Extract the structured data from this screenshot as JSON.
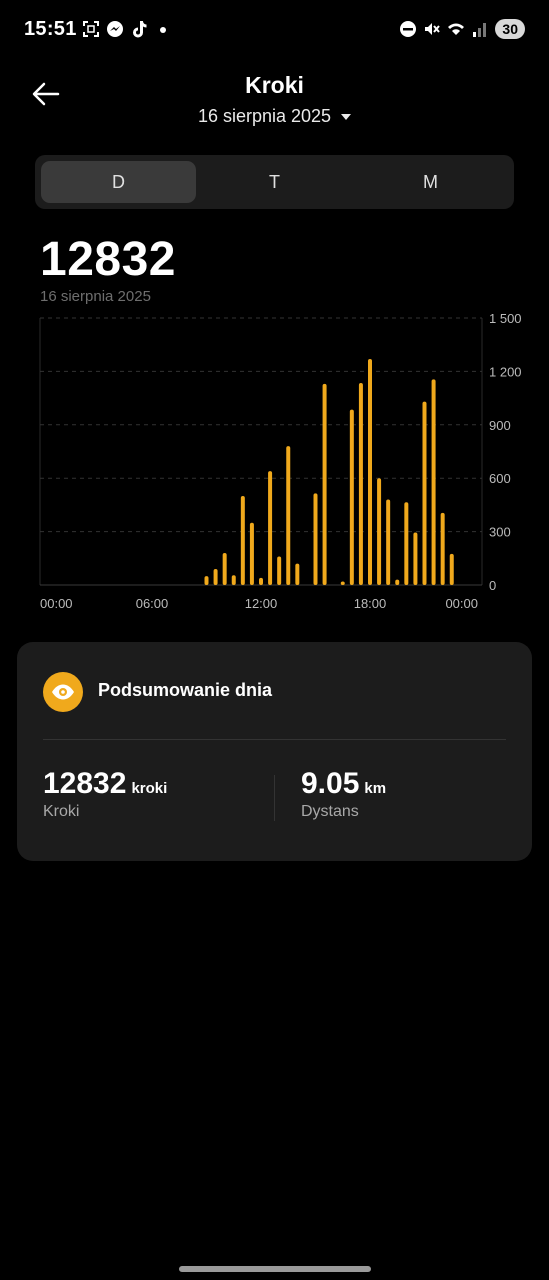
{
  "status_bar": {
    "time": "15:51",
    "battery": "30"
  },
  "header": {
    "title": "Kroki",
    "date": "16 sierpnia 2025"
  },
  "tabs": [
    {
      "label": "D",
      "active": true
    },
    {
      "label": "T",
      "active": false
    },
    {
      "label": "M",
      "active": false
    }
  ],
  "summary": {
    "total": "12832",
    "date": "16 sierpnia 2025"
  },
  "chart_data": {
    "type": "bar",
    "bar_color": "#f0a91c",
    "x_tick_labels": [
      "00:00",
      "06:00",
      "12:00",
      "18:00",
      "00:00"
    ],
    "y_ticks": [
      0,
      300,
      600,
      900,
      1200,
      1500
    ],
    "y_tick_labels": [
      "0",
      "300",
      "600",
      "900",
      "1 200",
      "1 500"
    ],
    "ylim": [
      0,
      1500
    ],
    "xlim_hours": [
      0,
      24
    ],
    "grid": true,
    "bars": [
      {
        "hour": 9.0,
        "value": 50
      },
      {
        "hour": 9.5,
        "value": 90
      },
      {
        "hour": 10.0,
        "value": 180
      },
      {
        "hour": 10.5,
        "value": 55
      },
      {
        "hour": 11.0,
        "value": 500
      },
      {
        "hour": 11.5,
        "value": 350
      },
      {
        "hour": 12.0,
        "value": 40
      },
      {
        "hour": 12.5,
        "value": 640
      },
      {
        "hour": 13.0,
        "value": 160
      },
      {
        "hour": 13.5,
        "value": 780
      },
      {
        "hour": 14.0,
        "value": 120
      },
      {
        "hour": 15.0,
        "value": 515
      },
      {
        "hour": 15.5,
        "value": 1130
      },
      {
        "hour": 16.5,
        "value": 20
      },
      {
        "hour": 17.0,
        "value": 985
      },
      {
        "hour": 17.5,
        "value": 1135
      },
      {
        "hour": 18.0,
        "value": 1270
      },
      {
        "hour": 18.5,
        "value": 600
      },
      {
        "hour": 19.0,
        "value": 480
      },
      {
        "hour": 19.5,
        "value": 30
      },
      {
        "hour": 20.0,
        "value": 465
      },
      {
        "hour": 20.5,
        "value": 295
      },
      {
        "hour": 21.0,
        "value": 1030
      },
      {
        "hour": 21.5,
        "value": 1155
      },
      {
        "hour": 22.0,
        "value": 405
      },
      {
        "hour": 22.5,
        "value": 175
      }
    ]
  },
  "day_summary": {
    "title": "Podsumowanie dnia",
    "steps_value": "12832",
    "steps_unit": "kroki",
    "steps_label": "Kroki",
    "distance_value": "9.05",
    "distance_unit": "km",
    "distance_label": "Dystans"
  }
}
